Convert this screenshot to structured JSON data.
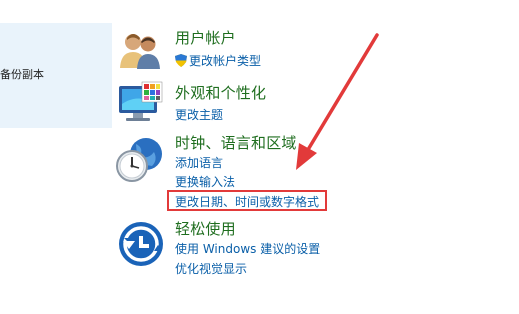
{
  "left_panel": {
    "text": "备份副本"
  },
  "categories": [
    {
      "title": "用户帐户",
      "icon": "users-icon",
      "links": [
        {
          "label": "更改帐户类型",
          "icon": "shield-icon"
        }
      ]
    },
    {
      "title": "外观和个性化",
      "icon": "monitor-palette-icon",
      "links": [
        {
          "label": "更改主题"
        }
      ]
    },
    {
      "title": "时钟、语言和区域",
      "icon": "clock-globe-icon",
      "links": [
        {
          "label": "添加语言"
        },
        {
          "label": "更换输入法"
        },
        {
          "label": "更改日期、时间或数字格式"
        }
      ]
    },
    {
      "title": "轻松使用",
      "icon": "ease-of-access-icon",
      "links": [
        {
          "label": "使用 Windows 建议的设置"
        },
        {
          "label": "优化视觉显示"
        }
      ]
    }
  ],
  "annotation": {
    "color": "#e23a3a"
  }
}
